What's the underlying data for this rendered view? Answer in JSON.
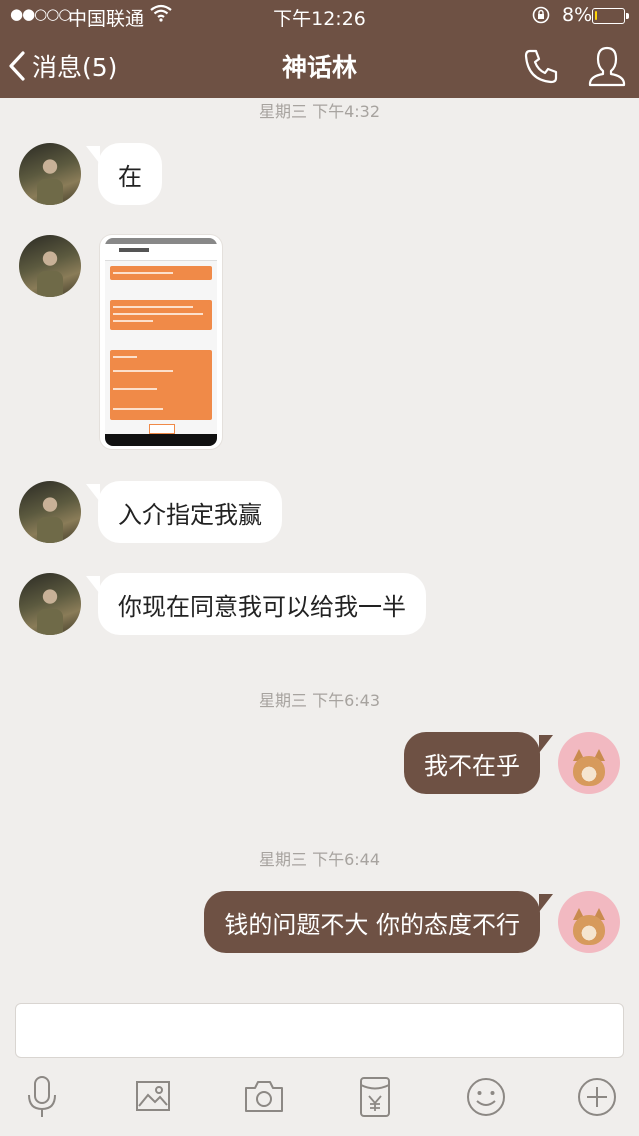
{
  "status_bar": {
    "signal": "●●○○○",
    "carrier": "中国联通",
    "time": "下午12:26",
    "battery": "8%",
    "battery_level": 0.08
  },
  "nav": {
    "back_label": "消息(5)",
    "title": "神话林"
  },
  "messages": [
    {
      "type": "timestamp",
      "text": "星期三 下午4:32"
    },
    {
      "type": "text",
      "side": "left",
      "text": "在"
    },
    {
      "type": "image",
      "side": "left"
    },
    {
      "type": "text",
      "side": "left",
      "text": "入介指定我赢"
    },
    {
      "type": "text",
      "side": "left",
      "text": "你现在同意我可以给我一半"
    },
    {
      "type": "timestamp",
      "text": "星期三 下午6:43"
    },
    {
      "type": "text",
      "side": "right",
      "text": "我不在乎"
    },
    {
      "type": "timestamp",
      "text": "星期三 下午6:44"
    },
    {
      "type": "text",
      "side": "right",
      "text": "钱的问题不大 你的态度不行"
    }
  ],
  "composer": {
    "value": ""
  },
  "toolbar": [
    "microphone-icon",
    "image-icon",
    "camera-icon",
    "red-packet-icon",
    "emoji-icon",
    "plus-icon"
  ],
  "colors": {
    "header": "#6e5144",
    "background": "#f0eeec",
    "outgoing_bubble": "#6e5144",
    "incoming_bubble": "#ffffff"
  }
}
